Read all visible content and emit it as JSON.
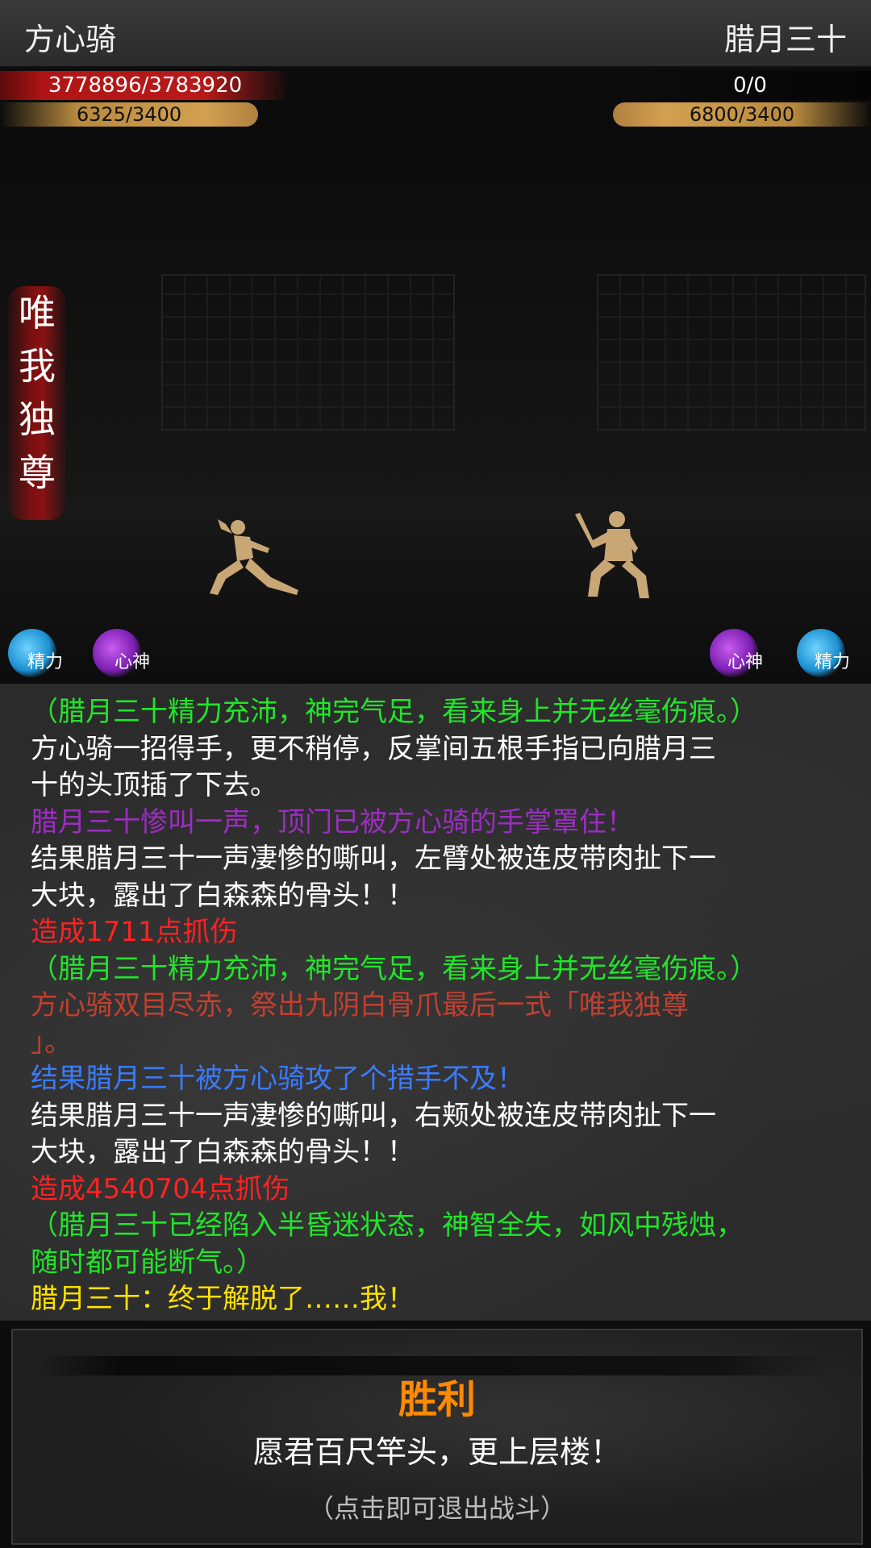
{
  "player": {
    "name": "方心骑",
    "hp": "3778896/3783920",
    "energy": "6325/3400"
  },
  "enemy": {
    "name": "腊月三十",
    "hp": "0/0",
    "energy": "6800/3400"
  },
  "skill_banner": [
    "唯",
    "我",
    "独",
    "尊"
  ],
  "status": {
    "player_energy_label": "精力",
    "player_mind_label": "心神",
    "enemy_mind_label": "心神",
    "enemy_energy_label": "精力"
  },
  "colors": {
    "green": "#22e52a",
    "white": "#ffffff",
    "purple": "#9b2ec0",
    "red": "#ff2222",
    "brown": "#c04030",
    "blue": "#3a7bff",
    "yellow": "#ffe100",
    "orange": "#ff8a00"
  },
  "log": [
    {
      "text": "（腊月三十精力充沛，神完气足，看来身上并无丝毫伤痕。）",
      "color": "#22e52a"
    },
    {
      "text": "方心骑一招得手，更不稍停，反掌间五根手指已向腊月三",
      "color": "#ffffff"
    },
    {
      "text": "十的头顶插了下去。",
      "color": "#ffffff"
    },
    {
      "text": "腊月三十惨叫一声，顶门已被方心骑的手掌罩住！",
      "color": "#9b2ec0"
    },
    {
      "text": "结果腊月三十一声凄惨的嘶叫，左臂处被连皮带肉扯下一",
      "color": "#ffffff"
    },
    {
      "text": "大块，露出了白森森的骨头！！",
      "color": "#ffffff"
    },
    {
      "text": "造成1711点抓伤",
      "color": "#ff2222"
    },
    {
      "text": "（腊月三十精力充沛，神完气足，看来身上并无丝毫伤痕。）",
      "color": "#22e52a"
    },
    {
      "text": "方心骑双目尽赤，祭出九阴白骨爪最后一式「唯我独尊",
      "color": "#c04030"
    },
    {
      "text": "」。",
      "color": "#c04030"
    },
    {
      "text": "结果腊月三十被方心骑攻了个措手不及！",
      "color": "#3a7bff"
    },
    {
      "text": "结果腊月三十一声凄惨的嘶叫，右颊处被连皮带肉扯下一",
      "color": "#ffffff"
    },
    {
      "text": "大块，露出了白森森的骨头！！",
      "color": "#ffffff"
    },
    {
      "text": "造成4540704点抓伤",
      "color": "#ff2222"
    },
    {
      "text": "（腊月三十已经陷入半昏迷状态，神智全失，如风中残烛，",
      "color": "#22e52a"
    },
    {
      "text": "随时都可能断气。）",
      "color": "#22e52a"
    },
    {
      "text": "腊月三十：终于解脱了……我！",
      "color": "#ffe100"
    }
  ],
  "result": {
    "title": "胜利",
    "motto": "愿君百尺竿头，更上层楼！",
    "hint": "（点击即可退出战斗）"
  }
}
